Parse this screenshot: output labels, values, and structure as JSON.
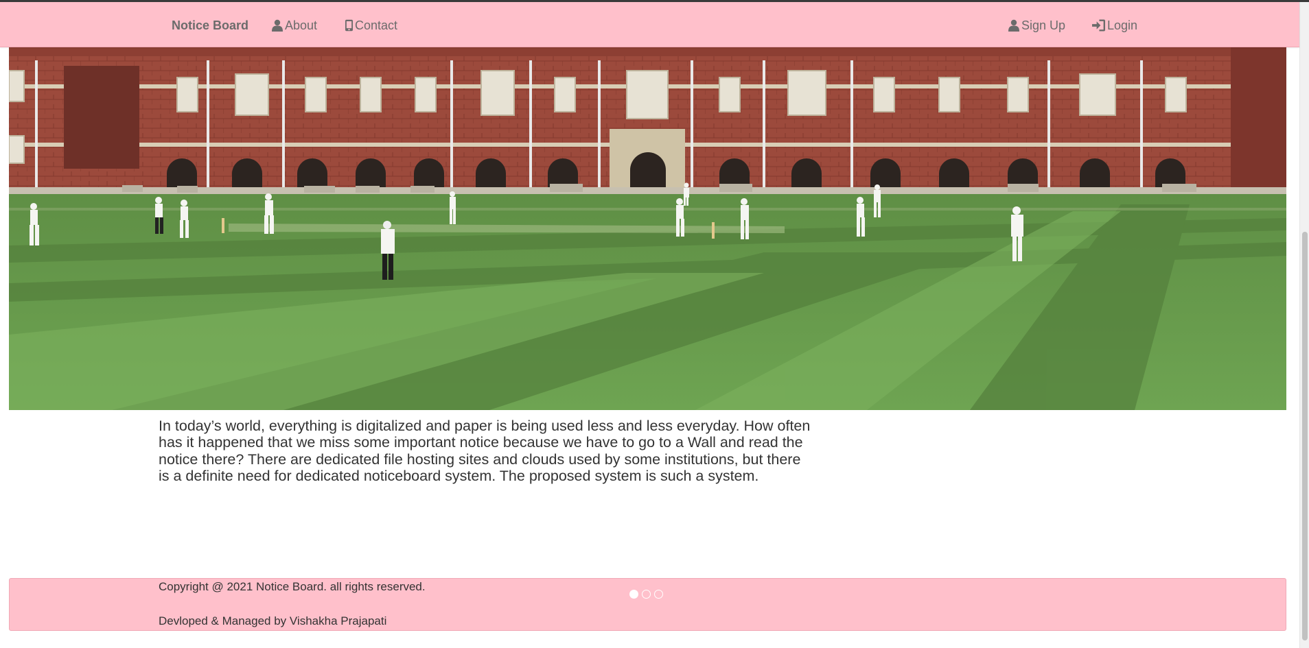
{
  "nav": {
    "brand": "Notice Board",
    "about": "About",
    "contact": "Contact",
    "signup": "Sign Up",
    "login": "Login",
    "icons": {
      "about": "user-icon",
      "contact": "mobile-phone-icon",
      "signup": "user-icon",
      "login": "log-in-icon"
    }
  },
  "hero": {
    "image": "photo of cricket match on a green field in front of a red-brick college building",
    "carousel": {
      "slides": 3,
      "active_index": 0
    }
  },
  "intro": {
    "text": "In today’s world, everything is digitalized and paper is being used less and less everyday. How often has it happened that we miss some important notice because we have to go to a Wall and read the notice there? There are dedicated file hosting sites and clouds used by some institutions, but there is a definite need for dedicated noticeboard system. The proposed system is such a system."
  },
  "footer": {
    "copyright": "Copyright @ 2021 Notice Board. all rights reserved.",
    "credit": "Devloped & Managed by Vishakha Prajapati"
  },
  "colors": {
    "nav_bg": "#ffc0cb",
    "footer_bg": "#ffc0cb",
    "text": "#333333",
    "nav_text": "#6b6b6b"
  }
}
